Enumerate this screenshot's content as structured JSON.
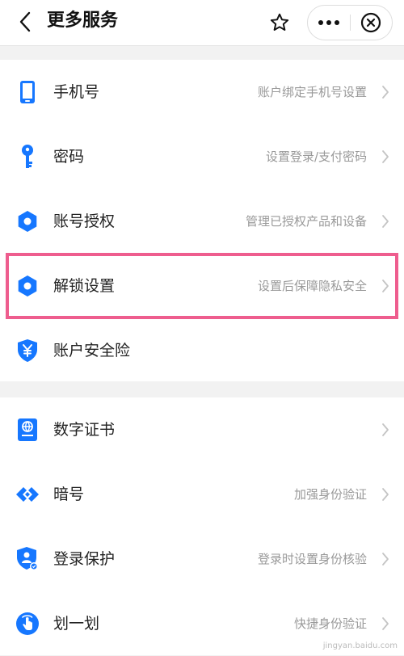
{
  "header": {
    "title": "更多服务"
  },
  "section1": {
    "items": [
      {
        "label": "手机号",
        "desc": "账户绑定手机号设置",
        "icon": "phone-icon"
      },
      {
        "label": "密码",
        "desc": "设置登录/支付密码",
        "icon": "key-icon"
      },
      {
        "label": "账号授权",
        "desc": "管理已授权产品和设备",
        "icon": "gear-icon"
      },
      {
        "label": "解锁设置",
        "desc": "设置后保障隐私安全",
        "icon": "gear-icon"
      },
      {
        "label": "账户安全险",
        "desc": "",
        "icon": "shield-yen-icon"
      }
    ]
  },
  "section2": {
    "items": [
      {
        "label": "数字证书",
        "desc": "",
        "icon": "certificate-icon"
      },
      {
        "label": "暗号",
        "desc": "加强身份验证",
        "icon": "cipher-icon"
      },
      {
        "label": "登录保护",
        "desc": "登录时设置身份核验",
        "icon": "login-shield-icon"
      },
      {
        "label": "划一划",
        "desc": "快捷身份验证",
        "icon": "swipe-hand-icon"
      }
    ]
  },
  "colors": {
    "accent": "#1677ff",
    "highlight": "#ee5d8e",
    "secondary_text": "#999999"
  },
  "watermark": "jingyan.baidu.com"
}
